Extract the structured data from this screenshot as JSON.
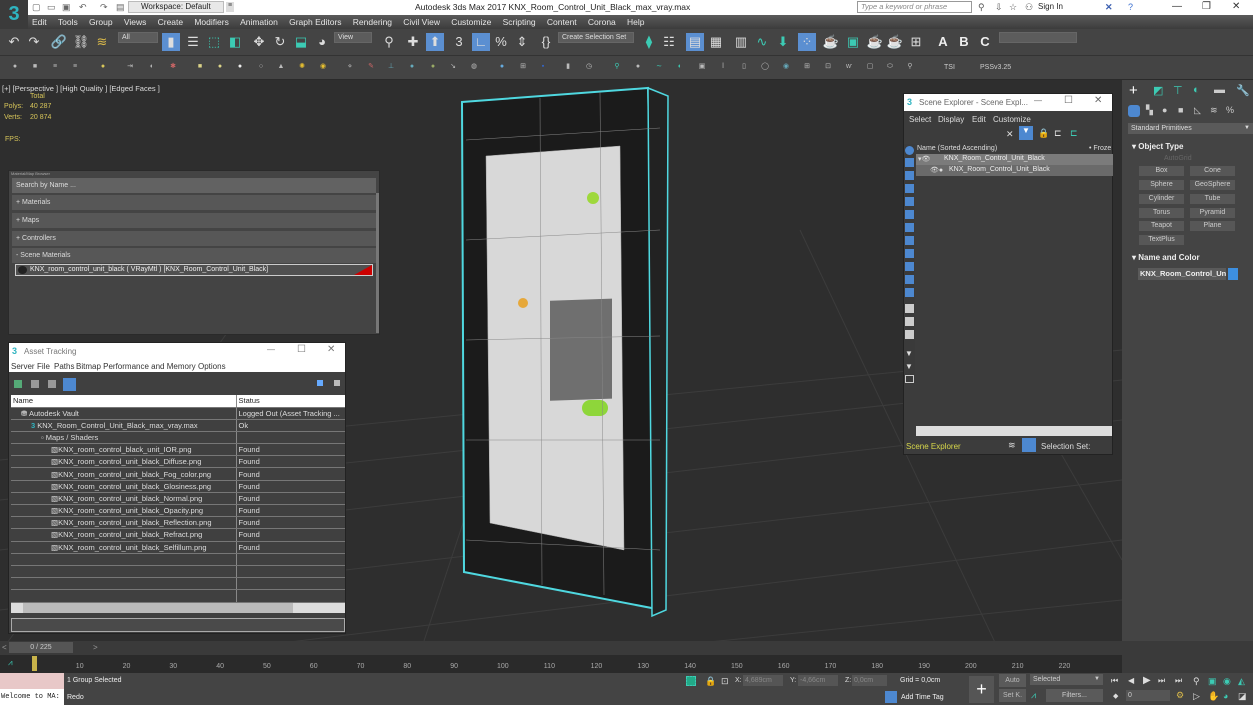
{
  "window": {
    "title": "Autodesk 3ds Max 2017     KNX_Room_Control_Unit_Black_max_vray.max",
    "workspace": "Workspace: Default",
    "search_placeholder": "Type a keyword or phrase",
    "sign_in": "Sign In"
  },
  "menu": [
    "Edit",
    "Tools",
    "Group",
    "Views",
    "Create",
    "Modifiers",
    "Animation",
    "Graph Editors",
    "Rendering",
    "Civil View",
    "Customize",
    "Scripting",
    "Content",
    "Corona",
    "Help"
  ],
  "toolbar": {
    "selection_filter": "All",
    "ref_coord": "View",
    "create_selection_set": "Create Selection Set",
    "tsi": "TSI",
    "pss": "PSSv3.25"
  },
  "viewport": {
    "label": "[+] [Perspective ] [High Quality ] [Edged Faces ]",
    "stats_total": "Total",
    "polys_label": "Polys:",
    "polys": "40 287",
    "verts_label": "Verts:",
    "verts": "20 874",
    "fps_label": "FPS:"
  },
  "material_browser": {
    "title": "Material/Map Browser",
    "search": "Search by Name ...",
    "sections": [
      "+ Materials",
      "+ Maps",
      "+ Controllers",
      "- Scene Materials"
    ],
    "scene_material": "KNX_room_control_unit_black  ( VRayMtl )  [KNX_Room_Control_Unit_Black]"
  },
  "asset_tracking": {
    "title": "Asset Tracking",
    "menu": [
      "Server",
      "File",
      "Paths",
      "Bitmap Performance and Memory",
      "Options"
    ],
    "columns": [
      "Name",
      "Status"
    ],
    "rows": [
      {
        "name": "Autodesk Vault",
        "status": "Logged Out (Asset Tracking ..."
      },
      {
        "name": "KNX_Room_Control_Unit_Black_max_vray.max",
        "status": "Ok"
      },
      {
        "name": "Maps / Shaders",
        "status": ""
      },
      {
        "name": "KNX_room_control_black_unit_IOR.png",
        "status": "Found"
      },
      {
        "name": "KNX_room_control_unit_black_Diffuse.png",
        "status": "Found"
      },
      {
        "name": "KNX_room_control_unit_black_Fog_color.png",
        "status": "Found"
      },
      {
        "name": "KNX_room_control_unit_black_Glosiness.png",
        "status": "Found"
      },
      {
        "name": "KNX_room_control_unit_black_Normal.png",
        "status": "Found"
      },
      {
        "name": "KNX_room_control_unit_black_Opacity.png",
        "status": "Found"
      },
      {
        "name": "KNX_room_control_unit_black_Reflection.png",
        "status": "Found"
      },
      {
        "name": "KNX_room_control_unit_black_Refract.png",
        "status": "Found"
      },
      {
        "name": "KNX_room_control_unit_black_Selfillum.png",
        "status": "Found"
      }
    ]
  },
  "scene_explorer": {
    "title": "Scene Explorer - Scene Expl...",
    "menu": [
      "Select",
      "Display",
      "Edit",
      "Customize"
    ],
    "column": "Name (Sorted Ascending)",
    "frozen_col": "• Froze",
    "items": [
      "KNX_Room_Control_Unit_Black",
      "KNX_Room_Control_Unit_Black"
    ],
    "footer": "Scene Explorer",
    "selection_set": "Selection Set:"
  },
  "command_panel": {
    "category": "Standard Primitives",
    "object_type": "Object Type",
    "autogrid": "AutoGrid",
    "buttons": [
      "Box",
      "Cone",
      "Sphere",
      "GeoSphere",
      "Cylinder",
      "Tube",
      "Torus",
      "Pyramid",
      "Teapot",
      "Plane",
      "TextPlus"
    ],
    "name_and_color": "Name and Color",
    "object_name": "KNX_Room_Control_Uni",
    "object_color": "#3d8fe0"
  },
  "timeline": {
    "frame": "0 / 225",
    "ticks": [
      "0",
      "10",
      "20",
      "30",
      "40",
      "50",
      "60",
      "70",
      "80",
      "90",
      "100",
      "110",
      "120",
      "130",
      "140",
      "150",
      "160",
      "170",
      "180",
      "190",
      "200",
      "210",
      "220"
    ]
  },
  "status": {
    "maxscript": "Welcome to MA:",
    "selected": "1 Group Selected",
    "prompt": "Redo",
    "x_label": "X:",
    "x": "4,689cm",
    "y_label": "Y:",
    "y": "-4,66cm",
    "z_label": "Z:",
    "z": "0,0cm",
    "grid": "Grid = 0,0cm",
    "add_time_tag": "Add Time Tag",
    "auto": "Auto",
    "set_key": "Set K.",
    "key_filter": "Selected",
    "filters": "Filters...",
    "frame_input": "0"
  }
}
